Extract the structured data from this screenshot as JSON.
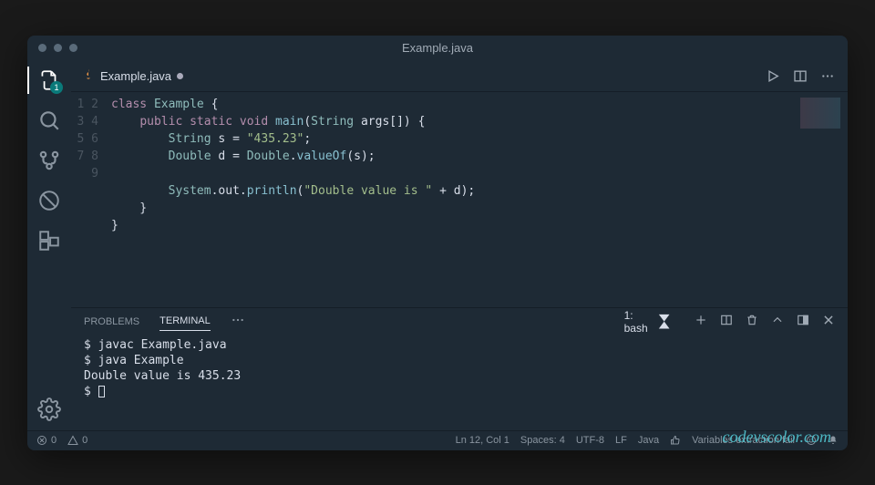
{
  "window": {
    "title": "Example.java"
  },
  "tab": {
    "filename": "Example.java"
  },
  "explorer_badge": "1",
  "gutter": [
    "1",
    "2",
    "3",
    "4",
    "5",
    "6",
    "7",
    "8",
    "9"
  ],
  "code_tokens": [
    [
      {
        "t": "class ",
        "c": "tok-k"
      },
      {
        "t": "Example",
        "c": "tok-c"
      },
      {
        "t": " {",
        "c": "tok-p"
      }
    ],
    [
      {
        "t": "    ",
        "c": ""
      },
      {
        "t": "public static void ",
        "c": "tok-k"
      },
      {
        "t": "main",
        "c": "tok-m"
      },
      {
        "t": "(",
        "c": "tok-p"
      },
      {
        "t": "String ",
        "c": "tok-c"
      },
      {
        "t": "args",
        "c": "tok-v"
      },
      {
        "t": "[]) {",
        "c": "tok-p"
      }
    ],
    [
      {
        "t": "        ",
        "c": ""
      },
      {
        "t": "String ",
        "c": "tok-c"
      },
      {
        "t": "s ",
        "c": "tok-v"
      },
      {
        "t": "= ",
        "c": "tok-p"
      },
      {
        "t": "\"435.23\"",
        "c": "tok-s"
      },
      {
        "t": ";",
        "c": "tok-p"
      }
    ],
    [
      {
        "t": "        ",
        "c": ""
      },
      {
        "t": "Double ",
        "c": "tok-c"
      },
      {
        "t": "d ",
        "c": "tok-v"
      },
      {
        "t": "= ",
        "c": "tok-p"
      },
      {
        "t": "Double",
        "c": "tok-c"
      },
      {
        "t": ".",
        "c": "tok-p"
      },
      {
        "t": "valueOf",
        "c": "tok-m"
      },
      {
        "t": "(",
        "c": "tok-p"
      },
      {
        "t": "s",
        "c": "tok-v"
      },
      {
        "t": ");",
        "c": "tok-p"
      }
    ],
    [],
    [
      {
        "t": "        ",
        "c": ""
      },
      {
        "t": "System",
        "c": "tok-c"
      },
      {
        "t": ".",
        "c": "tok-p"
      },
      {
        "t": "out",
        "c": "tok-v"
      },
      {
        "t": ".",
        "c": "tok-p"
      },
      {
        "t": "println",
        "c": "tok-m"
      },
      {
        "t": "(",
        "c": "tok-p"
      },
      {
        "t": "\"Double value is \"",
        "c": "tok-s"
      },
      {
        "t": " + ",
        "c": "tok-p"
      },
      {
        "t": "d",
        "c": "tok-v"
      },
      {
        "t": ");",
        "c": "tok-p"
      }
    ],
    [
      {
        "t": "    }",
        "c": "tok-p"
      }
    ],
    [
      {
        "t": "}",
        "c": "tok-p"
      }
    ],
    []
  ],
  "panel": {
    "tabs": {
      "problems": "PROBLEMS",
      "terminal": "TERMINAL"
    },
    "terminal_selector": "1: bash",
    "lines": [
      "$ javac Example.java",
      "$ java Example",
      "Double value is 435.23",
      "$ "
    ]
  },
  "watermark": "codevscolor.com",
  "status": {
    "errors": "0",
    "warnings": "0",
    "cursor": "Ln 12, Col 1",
    "spaces": "Spaces: 4",
    "encoding": "UTF-8",
    "eol": "LF",
    "lang": "Java",
    "feedback": "Variables extraction fail"
  }
}
